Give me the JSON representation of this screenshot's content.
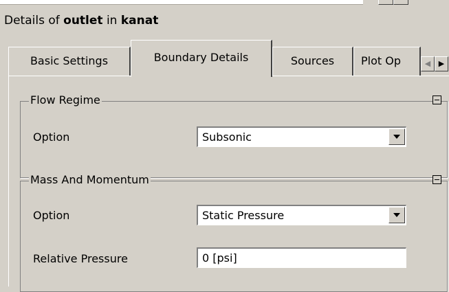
{
  "header": {
    "prefix": "Details of",
    "object_name": "outlet",
    "middle": "in",
    "domain_name": "kanat"
  },
  "tabs": [
    {
      "label": "Basic Settings",
      "active": false
    },
    {
      "label": "Boundary Details",
      "active": true
    },
    {
      "label": "Sources",
      "active": false
    },
    {
      "label": "Plot Op",
      "active": false
    }
  ],
  "tab_scroll": {
    "left_icon": "arrow-left-icon",
    "right_icon": "arrow-right-icon"
  },
  "flow_regime": {
    "title": "Flow Regime",
    "option_label": "Option",
    "option_value": "Subsonic"
  },
  "mass_momentum": {
    "title": "Mass And Momentum",
    "option_label": "Option",
    "option_value": "Static Pressure",
    "relative_pressure_label": "Relative Pressure",
    "relative_pressure_value": "0 [psi]"
  },
  "colors": {
    "background": "#d4d0c8",
    "field": "#ffffff"
  }
}
